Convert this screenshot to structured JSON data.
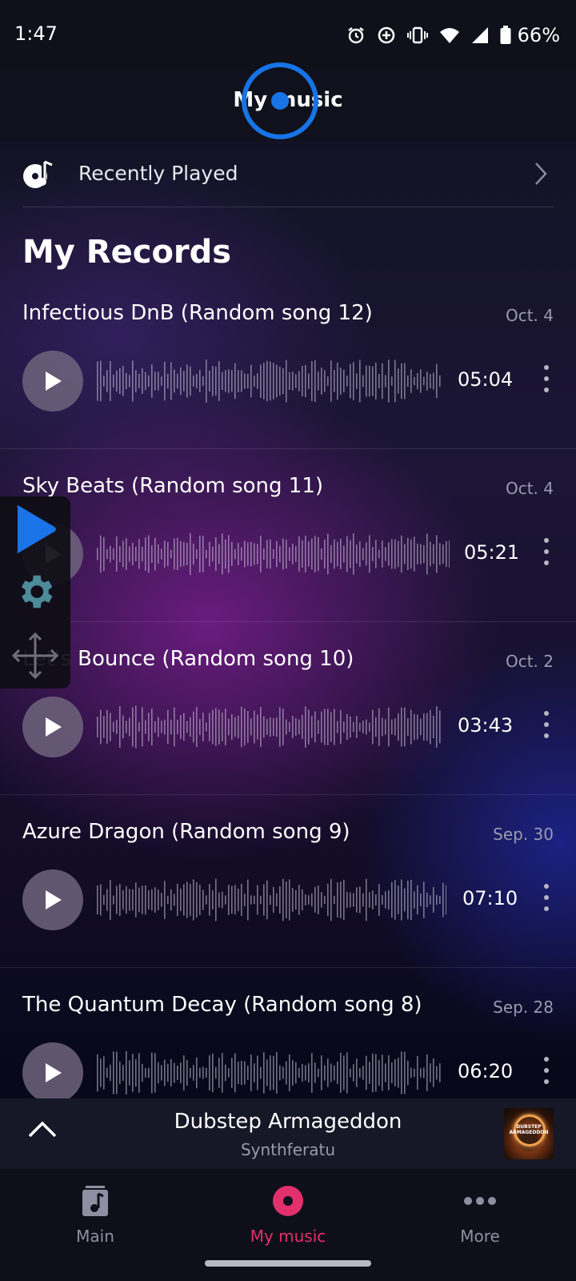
{
  "status_bar": {
    "time": "1:47",
    "battery": "66%",
    "icons": [
      "alarm-icon",
      "data-saver-icon",
      "vibrate-icon",
      "wifi-icon",
      "signal-icon",
      "battery-icon"
    ]
  },
  "header": {
    "title": "My music"
  },
  "recently_played": {
    "label": "Recently Played"
  },
  "section_title": "My Records",
  "records": [
    {
      "title": "Infectious DnB (Random song 12)",
      "date": "Oct. 4",
      "duration": "05:04"
    },
    {
      "title": "Sky Beats (Random song 11)",
      "date": "Oct. 4",
      "duration": "05:21"
    },
    {
      "title": "Let's Bounce (Random song 10)",
      "date": "Oct. 2",
      "duration": "03:43"
    },
    {
      "title": "Azure Dragon (Random song 9)",
      "date": "Sep. 30",
      "duration": "07:10"
    },
    {
      "title": "The Quantum Decay (Random song 8)",
      "date": "Sep. 28",
      "duration": "06:20"
    }
  ],
  "mini_player": {
    "title": "Dubstep Armageddon",
    "artist": "Synthferatu",
    "art_text": "DUBSTEP ARMAGEDDON"
  },
  "nav": {
    "items": [
      {
        "label": "Main",
        "icon": "music-note-icon"
      },
      {
        "label": "My music",
        "icon": "vinyl-record-icon",
        "active": true
      },
      {
        "label": "More",
        "icon": "more-dots-icon"
      }
    ]
  },
  "colors": {
    "accent": "#e1306c",
    "touch_indicator": "#1674e6",
    "toolbar_play": "#1a73e8"
  }
}
